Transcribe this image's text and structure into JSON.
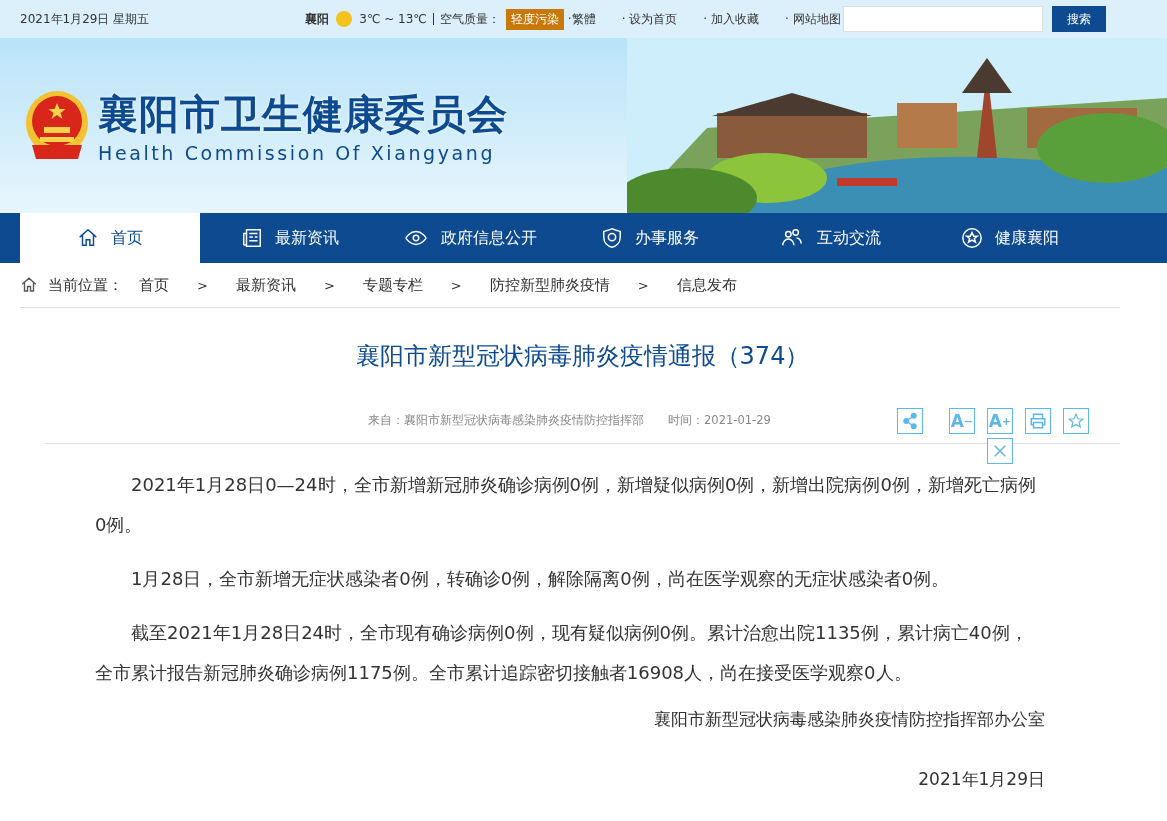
{
  "top_bar": {
    "date": "2021年1月29日  星期五",
    "city": "襄阳",
    "temperature": "3℃ ~ 13℃",
    "air_label": "空气质量：",
    "air_badge": "轻度污染",
    "links": [
      "·繁體",
      "· 设为首页",
      "· 加入收藏",
      "· 网站地图"
    ],
    "search_button": "搜索"
  },
  "banner": {
    "title": "襄阳市卫生健康委员会",
    "subtitle": "Health Commission Of Xiangyang"
  },
  "nav": [
    {
      "label": "首页",
      "kind": "home",
      "selected": true
    },
    {
      "label": "最新资讯",
      "kind": "news",
      "selected": false
    },
    {
      "label": "政府信息公开",
      "kind": "eye",
      "selected": false
    },
    {
      "label": "办事服务",
      "kind": "shield",
      "selected": false
    },
    {
      "label": "互动交流",
      "kind": "people",
      "selected": false
    },
    {
      "label": "健康襄阳",
      "kind": "star",
      "selected": false
    }
  ],
  "breadcrumb": {
    "label": "当前位置：",
    "items": [
      "首页",
      "最新资讯",
      "专题专栏",
      "防控新型肺炎疫情",
      "信息发布"
    ],
    "separator": ">"
  },
  "article": {
    "title": "襄阳市新型冠状病毒肺炎疫情通报（374）",
    "source": "来自：襄阳市新型冠状病毒感染肺炎疫情防控指挥部",
    "time": "时间：2021-01-29",
    "tools": [
      {
        "kind": "share"
      },
      {
        "kind": "font",
        "letter": "A",
        "sign": "−"
      },
      {
        "kind": "font",
        "letter": "A",
        "sign": "+"
      },
      {
        "kind": "print"
      },
      {
        "kind": "favorite"
      },
      {
        "kind": "close"
      }
    ],
    "paragraphs": [
      "2021年1月28日0—24时，全市新增新冠肺炎确诊病例0例，新增疑似病例0例，新增出院病例0例，新增死亡病例0例。",
      "1月28日，全市新增无症状感染者0例，转确诊0例，解除隔离0例，尚在医学观察的无症状感染者0例。",
      "截至2021年1月28日24时，全市现有确诊病例0例，现有疑似病例0例。累计治愈出院1135例，累计病亡40例，全市累计报告新冠肺炎确诊病例1175例。全市累计追踪密切接触者16908人，尚在接受医学观察0人。"
    ],
    "signature": "襄阳市新型冠状病毒感染肺炎疫情防控指挥部办公室",
    "date": "2021年1月29日"
  }
}
